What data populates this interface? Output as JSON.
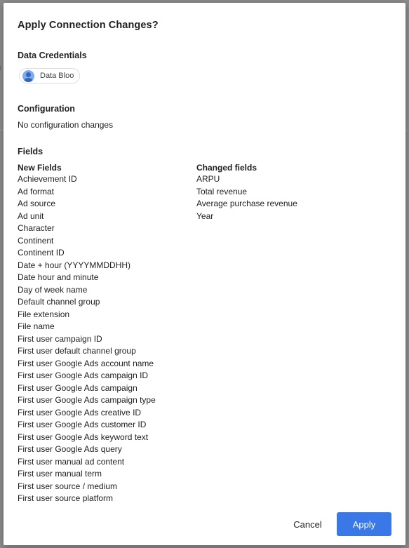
{
  "dialog": {
    "title": "Apply Connection Changes?"
  },
  "credentials": {
    "heading": "Data Credentials",
    "user_chip": "Data Bloo"
  },
  "configuration": {
    "heading": "Configuration",
    "text": "No configuration changes"
  },
  "fields": {
    "heading": "Fields",
    "new_fields_heading": "New Fields",
    "new_fields": [
      "Achievement ID",
      "Ad format",
      "Ad source",
      "Ad unit",
      "Character",
      "Continent",
      "Continent ID",
      "Date + hour (YYYYMMDDHH)",
      "Date hour and minute",
      "Day of week name",
      "Default channel group",
      "File extension",
      "File name",
      "First user campaign ID",
      "First user default channel group",
      "First user Google Ads account name",
      "First user Google Ads campaign ID",
      "First user Google Ads campaign",
      "First user Google Ads campaign type",
      "First user Google Ads creative ID",
      "First user Google Ads customer ID",
      "First user Google Ads keyword text",
      "First user Google Ads query",
      "First user manual ad content",
      "First user manual term",
      "First user source / medium",
      "First user source platform"
    ],
    "changed_fields_heading": "Changed fields",
    "changed_fields": [
      "ARPU",
      "Total revenue",
      "Average purchase revenue",
      "Year"
    ]
  },
  "footer": {
    "cancel_label": "Cancel",
    "apply_label": "Apply"
  },
  "colors": {
    "accent": "#3b78e7",
    "text": "#202124"
  }
}
